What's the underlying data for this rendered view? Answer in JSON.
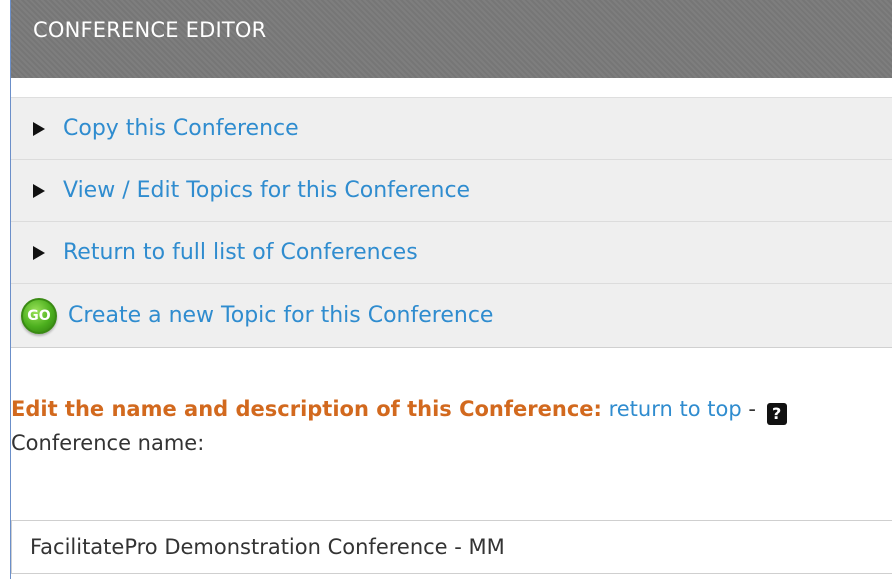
{
  "header": {
    "title": "CONFERENCE EDITOR"
  },
  "nav": {
    "items": [
      {
        "label": "Copy this Conference",
        "icon": "play-arrow-icon"
      },
      {
        "label": "View / Edit Topics for this Conference",
        "icon": "play-arrow-icon"
      },
      {
        "label": "Return to full list of Conferences",
        "icon": "play-arrow-icon"
      },
      {
        "label": "Create a new Topic for this Conference",
        "icon": "go-icon",
        "icon_text": "GO"
      }
    ]
  },
  "edit_section": {
    "title": "Edit the name and description of this Conference:",
    "return_link": "return to top",
    "separator": "-",
    "help_icon": "help-icon",
    "help_text": "?",
    "name_label": "Conference name:",
    "name_value": "FacilitatePro Demonstration Conference - MM"
  },
  "colors": {
    "header_bg": "#7a7a7a",
    "link": "#2f8ccf",
    "section_title": "#d2691e",
    "nav_bg": "#efefef"
  }
}
